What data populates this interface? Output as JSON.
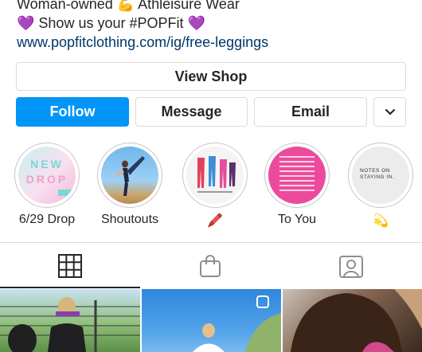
{
  "bio": {
    "line1": "Woman-owned 💪 Athleisure Wear",
    "line2": "💜 Show us your #POPFit 💜",
    "link": "www.popfitclothing.com/ig/free-leggings"
  },
  "buttons": {
    "view_shop": "View Shop",
    "follow": "Follow",
    "message": "Message",
    "email": "Email"
  },
  "highlights": [
    {
      "label": "6/29 Drop",
      "cover_line1": "NEW",
      "cover_line2": "DROP"
    },
    {
      "label": "Shoutouts"
    },
    {
      "label": "🖍️"
    },
    {
      "label": "To You"
    },
    {
      "label": "💫",
      "cover_text": "NOTES ON STAYING IN."
    }
  ],
  "tabs": [
    "grid-icon",
    "shop-bag-icon",
    "tagged-icon"
  ],
  "colors": {
    "accent": "#0095f6",
    "link": "#00376b",
    "border": "#dbdbdb"
  }
}
